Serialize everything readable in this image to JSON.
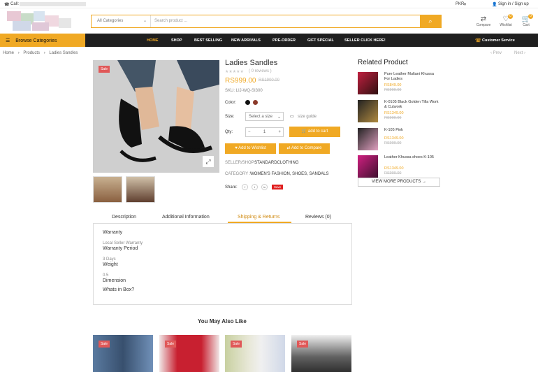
{
  "topbar": {
    "call_label": "Call:",
    "currency": "PKR",
    "signin": "Sign in / Sign up"
  },
  "search": {
    "category": "All Categories",
    "placeholder": "Search product ..."
  },
  "header_icons": {
    "compare": "Compare",
    "wishlist": "Wishlist",
    "wishlist_count": "0",
    "cart": "Cart",
    "cart_count": "0"
  },
  "nav": {
    "browse": "Browse Categories",
    "items": [
      "HOME",
      "SHOP",
      "BEST SELLING",
      "NEW ARRIVALS",
      "PRE-ORDER",
      "GIFT SPECIAL",
      "SELLER CLICK HERE!"
    ],
    "service": "Customer Service"
  },
  "breadcrumb": {
    "home": "Home",
    "products": "Products",
    "current": "Ladies Sandles",
    "prev": "Prev",
    "next": "Next"
  },
  "product": {
    "sale_badge": "Sale",
    "title": "Ladies Sandles",
    "reviews": "( 0 reviews )",
    "price": "RS999.00",
    "old_price": "RS1900.00",
    "sku": "SKU: LIJ-WQ-SI300",
    "color_label": "Color:",
    "colors": [
      "#111111",
      "#8b3a2a"
    ],
    "size_label": "Size:",
    "size_select": "Select a size",
    "size_guide": "size guide",
    "qty_label": "Qty:",
    "qty": "1",
    "add_to_cart": "add to cart",
    "add_wishlist": "Add to Wishlist",
    "add_compare": "Add to Compare",
    "seller_label": "SELLER/SHOP :",
    "seller": "STANDARDCLOTHING",
    "category_label": "CATEGORY :",
    "category": "WOMEN'S FASHION, SHOES, SANDALS",
    "share_label": "Share:",
    "share_icons": [
      "f",
      "t",
      "in"
    ],
    "save_label": "Save"
  },
  "tabs": {
    "items": [
      "Description",
      "Additional Information",
      "Shipping & Returns",
      "Reviews (0)"
    ],
    "active": 2
  },
  "tab_content": {
    "warranty": "Warranty",
    "warranty_type_label": "Local Seller Warranty",
    "warranty_period": "Warranty Period",
    "period_value": "3 Days",
    "weight": "Weight",
    "weight_value": "0.5",
    "dimension": "Dimension",
    "whats_in_box": "Whats in Box?"
  },
  "related": {
    "title": "Related Product",
    "items": [
      {
        "name": "Pure Leather Multani Khussa For Ladies",
        "price": "RS849.00",
        "old": "RS999.00"
      },
      {
        "name": "K-0105 Black Golden Tilla Work & Cutwork",
        "price": "RS1349.00",
        "old": "RS999.00"
      },
      {
        "name": "K-105 Pink",
        "price": "RS1349.00",
        "old": "RS999.00"
      },
      {
        "name": "Leather Khussa shoes K-105",
        "price": "RS1349.00",
        "old": "RS999.00"
      }
    ],
    "view_more": "VIEW MORE PRODUCTS"
  },
  "also_like": {
    "title": "You May Also Like",
    "sale": "Sale"
  }
}
